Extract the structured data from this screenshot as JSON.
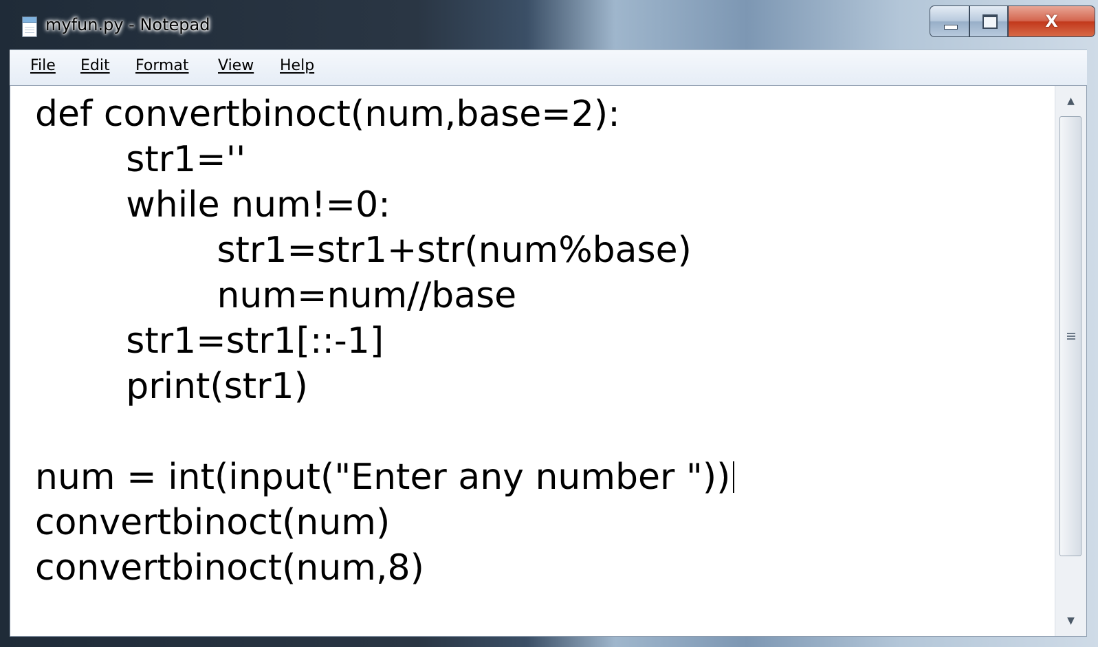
{
  "window": {
    "title": "myfun.py - Notepad",
    "buttons": {
      "minimize": "—",
      "maximize": "",
      "close": "X"
    }
  },
  "menu": [
    {
      "label": "File"
    },
    {
      "label": "Edit"
    },
    {
      "label": "Format"
    },
    {
      "label": "View"
    },
    {
      "label": "Help"
    }
  ],
  "editor": {
    "lines": [
      "def convertbinoct(num,base=2):",
      "        str1=''",
      "        while num!=0:",
      "                str1=str1+str(num%base)",
      "                num=num//base",
      "        str1=str1[::-1]",
      "        print(str1)",
      "",
      "num = int(input(\"Enter any number \"))",
      "convertbinoct(num)",
      "convertbinoct(num,8)"
    ]
  },
  "scrollbar": {
    "up_arrow": "▲",
    "down_arrow": "▼",
    "grip_icon": "grip-icon"
  }
}
